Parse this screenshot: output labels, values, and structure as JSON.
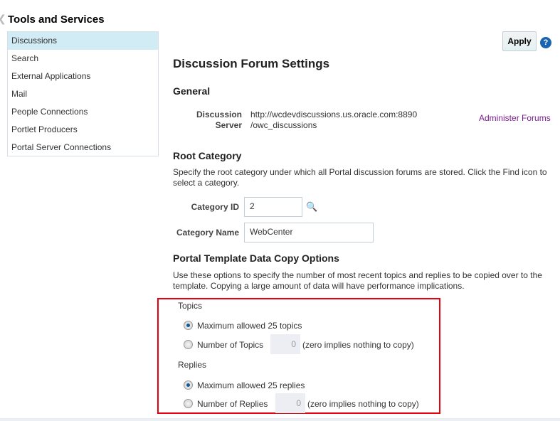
{
  "sidebar": {
    "title": "Tools and Services",
    "items": [
      {
        "label": "Discussions"
      },
      {
        "label": "Search"
      },
      {
        "label": "External Applications"
      },
      {
        "label": "Mail"
      },
      {
        "label": "People Connections"
      },
      {
        "label": "Portlet Producers"
      },
      {
        "label": "Portal Server Connections"
      }
    ]
  },
  "toolbar": {
    "apply": "Apply",
    "help": "?"
  },
  "main": {
    "title": "Discussion Forum Settings",
    "general": {
      "heading": "General",
      "server_label_1": "Discussion",
      "server_label_2": "Server",
      "server_value_1": "http://wcdevdiscussions.us.oracle.com:8890",
      "server_value_2": "/owc_discussions",
      "administer_link": "Administer Forums"
    },
    "root": {
      "heading": "Root Category",
      "desc": "Specify the root category under which all Portal discussion forums are stored. Click the Find icon to select a category.",
      "id_label": "Category ID",
      "id_value": "2",
      "name_label": "Category Name",
      "name_value": "WebCenter"
    },
    "copy": {
      "heading": "Portal Template Data Copy Options",
      "desc": "Use these options to specify the number of most recent topics and replies to be copied over to the template. Copying a large amount of data will have performance implications.",
      "topics_label": "Topics",
      "topics_max": "Maximum allowed 25 topics",
      "topics_num_label": "Number of Topics",
      "topics_num_value": "0",
      "topics_hint": "(zero implies nothing to copy)",
      "replies_label": "Replies",
      "replies_max": "Maximum allowed 25 replies",
      "replies_num_label": "Number of Replies",
      "replies_num_value": "0",
      "replies_hint": "(zero implies nothing to copy)"
    }
  }
}
